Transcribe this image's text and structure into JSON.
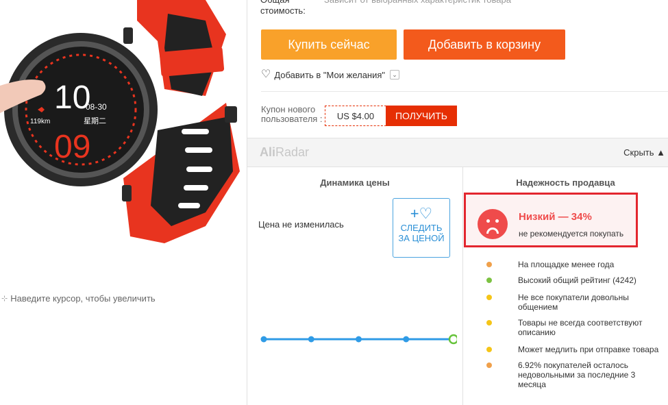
{
  "product": {
    "zoom_hint": "Наведите курсор, чтобы увеличить",
    "watch_face": {
      "big_hour": "10",
      "big_min": "09",
      "date": "08-30",
      "weekday": "星期二",
      "distance": "119km"
    }
  },
  "order": {
    "total_label": "Общая стоимость:",
    "total_value": "Зависит от выбранных характеристик товара",
    "buy_now": "Купить сейчас",
    "add_to_cart": "Добавить в корзину",
    "wishlist": "Добавить в \"Мои желания\"",
    "coupon_label": "Купон нового пользователя :",
    "coupon_value": "US $4.00",
    "coupon_button": "ПОЛУЧИТЬ"
  },
  "aliradar": {
    "logo_a": "Ali",
    "logo_b": "Radar",
    "hide": "Скрыть ▲",
    "price_title": "Динамика цены",
    "price_status": "Цена не изменилась",
    "track_line1": "СЛЕДИТЬ",
    "track_line2": "ЗА ЦЕНОЙ",
    "seller_title": "Надежность продавца",
    "level": "Низкий — 34%",
    "recommendation": "не рекомендуется покупать",
    "facts": [
      {
        "text": "На площадке менее года",
        "color": "#f0a04b"
      },
      {
        "text": "Высокий общий рейтинг (4242)",
        "color": "#7cc242"
      },
      {
        "text": "Не все покупатели довольны общением",
        "color": "#f5c518"
      },
      {
        "text": "Товары не всегда соответствуют описанию",
        "color": "#f5c518"
      },
      {
        "text": "Может медлить при отправке товара",
        "color": "#f5c518"
      },
      {
        "text": "6.92% покупателей осталось недовольными за последние 3 месяца",
        "color": "#f0a04b"
      }
    ]
  },
  "chart_data": {
    "type": "line",
    "x": [
      1,
      2,
      3,
      4,
      5
    ],
    "values": [
      4,
      4,
      4,
      4,
      4
    ],
    "title": "",
    "xlabel": "",
    "ylabel": ""
  },
  "colors": {
    "buy": "#f9a12a",
    "cart": "#f35a1c",
    "coupon": "#e62e04",
    "alert": "#e3262e",
    "line": "#2f9be6",
    "last_point": "#66c33a"
  }
}
